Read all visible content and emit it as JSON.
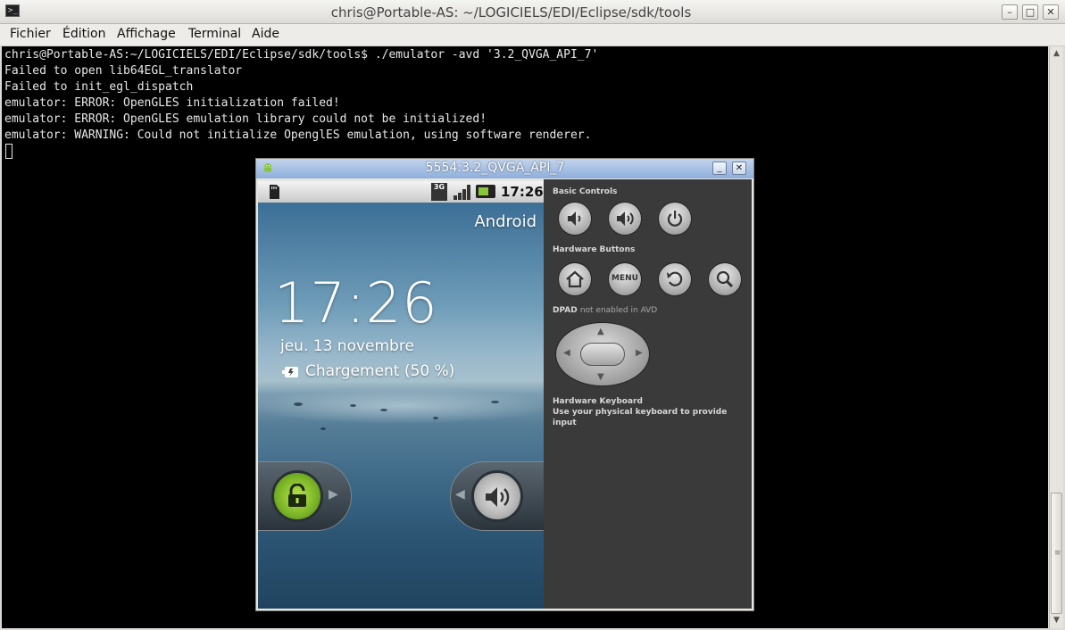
{
  "terminal_window": {
    "title": "chris@Portable-AS: ~/LOGICIELS/EDI/Eclipse/sdk/tools",
    "icon_glyph": ">_",
    "menu": [
      {
        "label": "Fichier"
      },
      {
        "label": "Édition"
      },
      {
        "label": "Affichage"
      },
      {
        "label": "Terminal"
      },
      {
        "label": "Aide"
      }
    ],
    "lines": [
      "chris@Portable-AS:~/LOGICIELS/EDI/Eclipse/sdk/tools$ ./emulator -avd '3.2_QVGA_API_7'",
      "Failed to open lib64EGL_translator",
      "Failed to init_egl_dispatch",
      "emulator: ERROR: OpenGLES initialization failed!",
      "emulator: ERROR: OpenGLES emulation library could not be initialized!",
      "emulator: WARNING: Could not initialize OpenglES emulation, using software renderer."
    ],
    "window_buttons": {
      "minimize": "–",
      "maximize": "□",
      "close": "✕"
    }
  },
  "emulator_window": {
    "title": "5554:3.2_QVGA_API_7",
    "window_buttons": {
      "minimize": "_",
      "close": "✕"
    },
    "phone": {
      "status_bar": {
        "network": "3G",
        "time": "17:26"
      },
      "carrier_label": "Android",
      "clock": "17:26",
      "date": "jeu. 13 novembre",
      "charging": "Chargement (50 %)"
    },
    "controls": {
      "basic_heading": "Basic Controls",
      "hardware_heading": "Hardware Buttons",
      "menu_button_label": "MENU",
      "dpad_heading": "DPAD",
      "dpad_note": "not enabled in AVD",
      "keyboard_heading": "Hardware Keyboard",
      "keyboard_note": "Use your physical keyboard to provide input"
    }
  },
  "icons": [
    "terminal-icon",
    "android-icon",
    "sd-card-icon",
    "signal-icon",
    "battery-icon",
    "charging-icon",
    "unlock-icon",
    "sound-icon",
    "volume-down-icon",
    "volume-up-icon",
    "power-icon",
    "home-icon",
    "back-icon",
    "search-icon"
  ],
  "colors": {
    "terminal_bg": "#000000",
    "terminal_fg": "#e8e8e8",
    "emulator_title_bg": "#8eaedb",
    "controls_bg": "#3a3a3a",
    "unlock_green": "#8bc43f"
  }
}
